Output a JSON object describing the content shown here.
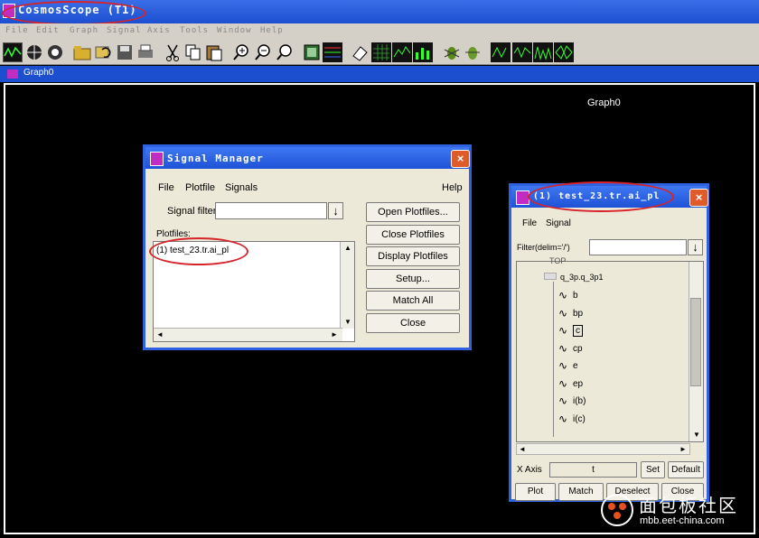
{
  "app": {
    "title": "CosmosScope (T1)"
  },
  "menubar": [
    "File",
    "Edit",
    "Graph",
    "Signal",
    "Axis",
    "Tools",
    "Window",
    "Help"
  ],
  "graph": {
    "tab_label": "Graph0",
    "label": "Graph0"
  },
  "signal_manager": {
    "title": "Signal Manager",
    "menu": [
      "File",
      "Plotfile",
      "Signals"
    ],
    "help": "Help",
    "signal_filter_label": "Signal filter",
    "signal_filter_value": "",
    "plotfiles_label": "Plotfiles:",
    "plotfiles": [
      "(1) test_23.tr.ai_pl"
    ],
    "buttons": [
      "Open Plotfiles...",
      "Close Plotfiles",
      "Display Plotfiles",
      "Setup...",
      "Match All",
      "Close"
    ]
  },
  "plotfile_window": {
    "title": "(1) test_23.tr.ai_pl",
    "menu": [
      "File",
      "Signal"
    ],
    "filter_label": "Filter(delim='/')",
    "filter_value": "",
    "tree_top": "TOP",
    "tree_node": "q_3p.q_3p1",
    "signals": [
      "b",
      "bp",
      "c",
      "cp",
      "e",
      "ep",
      "i(b)",
      "i(c)"
    ],
    "xaxis_label": "X Axis",
    "xaxis_value": "t",
    "set_label": "Set",
    "default_label": "Default",
    "bottom_buttons": [
      "Plot",
      "Match",
      "Deselect",
      "Close"
    ]
  },
  "watermark": {
    "brand": "面包板社区",
    "url": "mbb.eet-china.com"
  },
  "colors": {
    "title_blue": "#1c4fd0",
    "highlight_red": "#d6242a",
    "dialog_bg": "#ece9d8",
    "graph_bg": "#000000"
  }
}
